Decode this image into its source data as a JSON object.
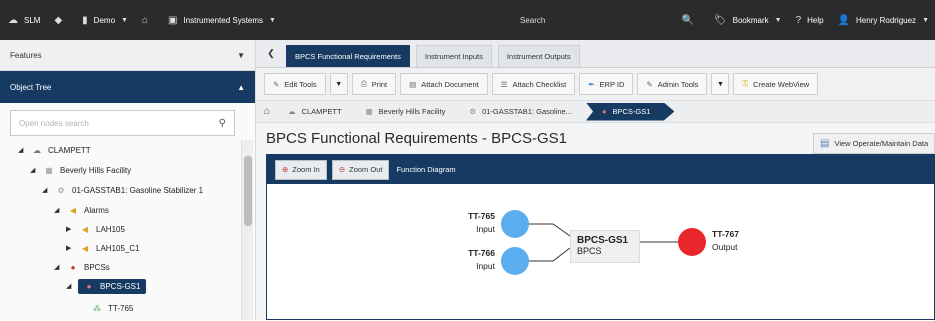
{
  "topbar": {
    "app_name": "SLM",
    "site": "Demo",
    "instrumented_systems": "Instrumented Systems",
    "search_label": "Search",
    "bookmark_label": "Bookmark",
    "help_label": "Help",
    "user_name": "Henry Rodriguez"
  },
  "sidebar": {
    "features_label": "Features",
    "object_tree_label": "Object Tree",
    "search_placeholder": "Open nodes search",
    "tree": [
      {
        "label": "CLAMPETT",
        "icon": "cloud-icon"
      },
      {
        "label": "Beverly Hills Facility",
        "icon": "facility-icon"
      },
      {
        "label": "01-GASSTAB1: Gasoline Stabilizer 1",
        "icon": "equipment-icon"
      },
      {
        "label": "Alarms",
        "icon": "alarm-bell-icon"
      },
      {
        "label": "LAH105",
        "icon": "alarm-bell-icon"
      },
      {
        "label": "LAH105_C1",
        "icon": "alarm-bell-icon"
      },
      {
        "label": "BPCSs",
        "icon": "bpcs-icon"
      },
      {
        "label": "BPCS-GS1",
        "icon": "bpcs-icon"
      },
      {
        "label": "TT-765",
        "icon": "instrument-icon"
      }
    ]
  },
  "tabs": {
    "items": [
      {
        "label": "BPCS Functional Requirements",
        "active": true
      },
      {
        "label": "Instrument Inputs",
        "active": false
      },
      {
        "label": "Instrument Outputs",
        "active": false
      }
    ]
  },
  "toolbar": {
    "edit_tools": "Edit Tools",
    "print": "Print",
    "attach_document": "Attach Document",
    "attach_checklist": "Attach Checklist",
    "erp_id": "ERP ID",
    "admin_tools": "Admin Tools",
    "create_webview": "Create WebView"
  },
  "breadcrumb": {
    "items": [
      "CLAMPETT",
      "Beverly Hills Facility",
      "01-GASSTAB1: Gasoline...",
      "BPCS-GS1"
    ]
  },
  "page": {
    "title": "BPCS Functional Requirements - BPCS-GS1",
    "view_operate_label": "View Operate/Maintain Data"
  },
  "diagram": {
    "zoom_in": "Zoom In",
    "zoom_out": "Zoom Out",
    "title": "Function Diagram",
    "colors": {
      "input": "#5aaef0",
      "output": "#e8262b"
    },
    "inputs": [
      {
        "tag": "TT-765",
        "type": "Input"
      },
      {
        "tag": "TT-766",
        "type": "Input"
      }
    ],
    "function": {
      "tag": "BPCS-GS1",
      "type": "BPCS"
    },
    "outputs": [
      {
        "tag": "TT-767",
        "type": "Output"
      }
    ]
  }
}
